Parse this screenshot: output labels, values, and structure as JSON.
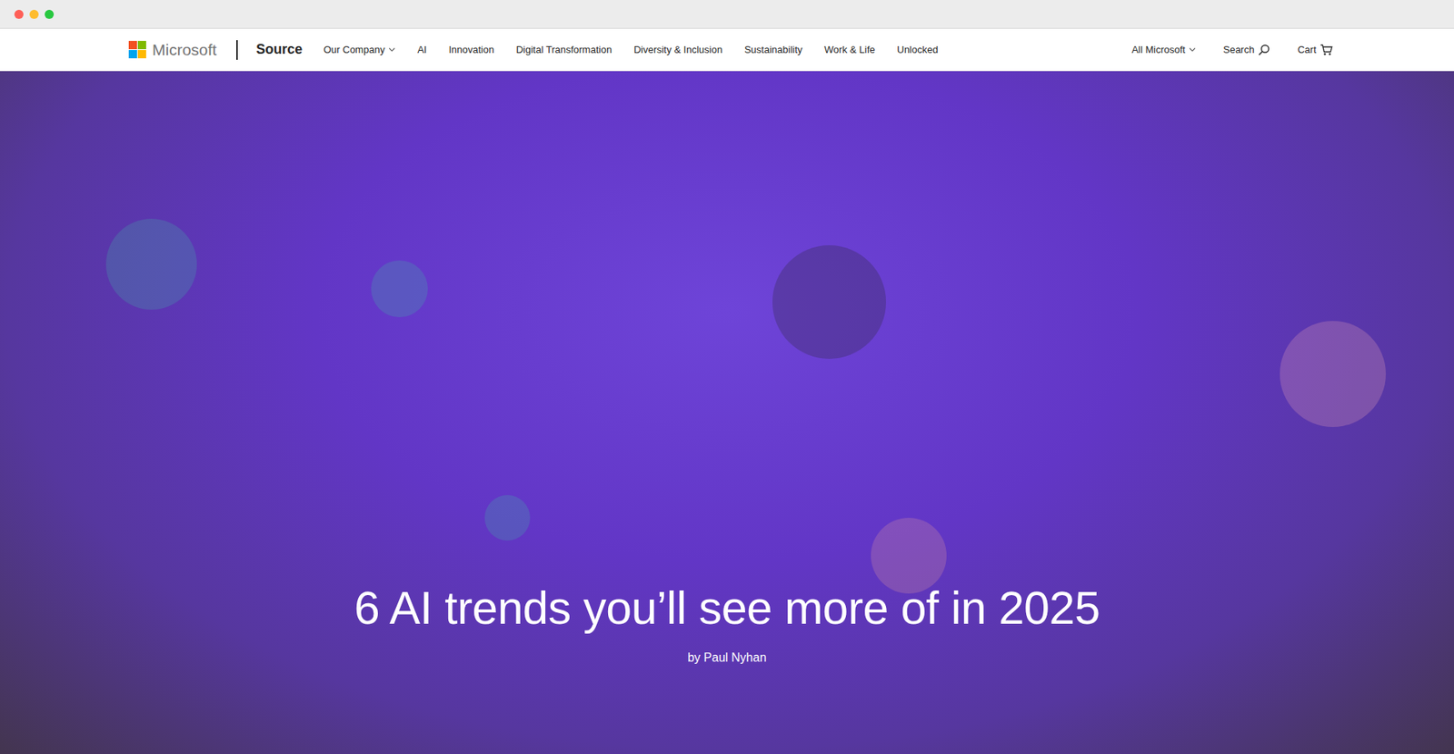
{
  "nav": {
    "brand": "Microsoft",
    "site": "Source",
    "items": [
      {
        "label": "Our Company",
        "kind": "menu"
      },
      {
        "label": "AI",
        "kind": "link"
      },
      {
        "label": "Innovation",
        "kind": "link"
      },
      {
        "label": "Digital Transformation",
        "kind": "link"
      },
      {
        "label": "Diversity & Inclusion",
        "kind": "link"
      },
      {
        "label": "Sustainability",
        "kind": "link"
      },
      {
        "label": "Work & Life",
        "kind": "link"
      },
      {
        "label": "Unlocked",
        "kind": "link"
      }
    ],
    "right": [
      {
        "label": "All Microsoft",
        "kind": "menu"
      },
      {
        "label": "Search",
        "kind": "search"
      },
      {
        "label": "Cart",
        "kind": "cart"
      }
    ]
  },
  "hero": {
    "title": "6 AI trends you’ll see more of in 2025",
    "byline": "by Paul Nyhan"
  }
}
